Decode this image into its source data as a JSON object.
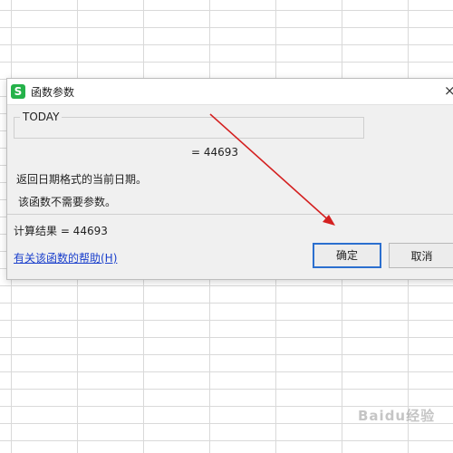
{
  "dialog": {
    "title": "函数参数",
    "app_icon_letter": "S",
    "close_glyph": "×",
    "function_name": "TODAY",
    "value_line": "=  44693",
    "description_1": "返回日期格式的当前日期。",
    "description_2": "该函数不需要参数。",
    "result_line": "计算结果  =   44693",
    "help_link": "有关该函数的帮助(H)",
    "ok_label": "确定",
    "cancel_label": "取消"
  },
  "annotation": {
    "arrow_color": "#d42020"
  },
  "watermark": "Baidu经验",
  "colors": {
    "app_icon": "#25b24a",
    "link": "#1a3fcc",
    "ok_border": "#2b6fcf"
  }
}
